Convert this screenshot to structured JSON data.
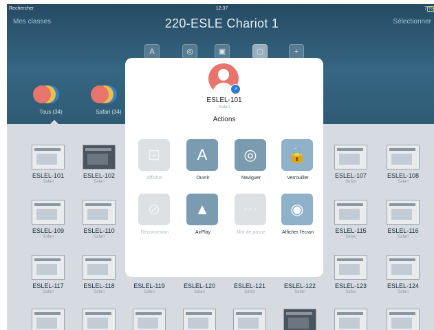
{
  "status_bar": {
    "back_label": "Rechercher",
    "time": "12:37",
    "right": "7 %"
  },
  "header": {
    "left_link": "Mes classes",
    "title": "220-ESLE Chariot 1",
    "right_link": "Sélectionner",
    "tools": [
      {
        "icon": "appstore-icon",
        "glyph": "A"
      },
      {
        "icon": "safari-icon",
        "glyph": "◎"
      },
      {
        "icon": "lock-icon",
        "glyph": "▣"
      },
      {
        "icon": "screen-icon",
        "glyph": "▢"
      },
      {
        "icon": "add-icon",
        "glyph": "+"
      }
    ],
    "groups": [
      {
        "label": "Tous (34)"
      },
      {
        "label": "Safari (34)"
      }
    ]
  },
  "colors": {
    "header": "#2f5a74",
    "avatar": "#e7756d",
    "action_icon": "#7b9bb0",
    "badge": "#2a7bd1"
  },
  "devices": [
    {
      "name": "ESLEL-101",
      "sub": "Safari"
    },
    {
      "name": "ESLEL-102",
      "sub": "Safari"
    },
    {
      "name": "ESLEL-107",
      "sub": "Safari"
    },
    {
      "name": "ESLEL-108",
      "sub": "Safari"
    },
    {
      "name": "ESLEL-109",
      "sub": "Safari"
    },
    {
      "name": "ESLEL-110",
      "sub": "Safari"
    },
    {
      "name": "ESLEL-115",
      "sub": "Safari"
    },
    {
      "name": "ESLEL-116",
      "sub": "Safari"
    },
    {
      "name": "ESLEL-117",
      "sub": "Safari"
    },
    {
      "name": "ESLEL-118",
      "sub": "Safari"
    },
    {
      "name": "ESLEL-119",
      "sub": "Safari"
    },
    {
      "name": "ESLEL-120",
      "sub": "Safari"
    },
    {
      "name": "ESLEL-121",
      "sub": "Safari"
    },
    {
      "name": "ESLEL-122",
      "sub": "Safari"
    },
    {
      "name": "ESLEL-123",
      "sub": "Safari"
    },
    {
      "name": "ESLEL-124",
      "sub": "Safari"
    }
  ],
  "sheet": {
    "device_name": "ESLEL-101",
    "device_app": "Safari",
    "actions_title": "Actions",
    "actions": [
      {
        "label": "Afficher",
        "icon": "show-app-icon",
        "glyph": "⊡",
        "enabled": false
      },
      {
        "label": "Ouvrir",
        "icon": "appstore-icon",
        "glyph": "A",
        "enabled": true
      },
      {
        "label": "Naviguer",
        "icon": "safari-compass-icon",
        "glyph": "◎",
        "enabled": true
      },
      {
        "label": "Verrouiller",
        "icon": "lock-icon",
        "glyph": "🔒",
        "enabled": true
      },
      {
        "label": "Déconnexion",
        "icon": "logout-icon",
        "glyph": "⊘",
        "enabled": false
      },
      {
        "label": "AirPlay",
        "icon": "airplay-icon",
        "glyph": "▲",
        "enabled": true
      },
      {
        "label": "Mot de passe",
        "icon": "passcode-icon",
        "glyph": "∘∘∘",
        "enabled": false
      },
      {
        "label": "Afficher l'écran",
        "icon": "view-screen-icon",
        "glyph": "◉",
        "enabled": true
      }
    ]
  }
}
